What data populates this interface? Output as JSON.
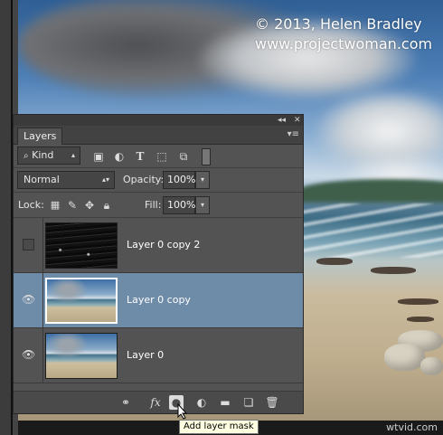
{
  "copyright": {
    "line1": "© 2013, Helen Bradley",
    "line2": "www.projectwoman.com"
  },
  "panel": {
    "collapse_icon": "double-chevron-left-icon",
    "close_icon": "close-icon",
    "tab_label": "Layers",
    "menu_icon": "panel-menu-icon"
  },
  "filter": {
    "kind_label": "Kind",
    "icons": [
      "pixel-filter-icon",
      "adjustment-filter-icon",
      "type-filter-icon",
      "shape-filter-icon",
      "smart-object-filter-icon"
    ]
  },
  "blend": {
    "mode": "Normal",
    "opacity_label": "Opacity:",
    "opacity_value": "100%"
  },
  "lock": {
    "label": "Lock:",
    "fill_label": "Fill:",
    "fill_value": "100%"
  },
  "layers": [
    {
      "name": "Layer 0 copy 2",
      "visible": false,
      "selected": false
    },
    {
      "name": "Layer 0 copy",
      "visible": true,
      "selected": true
    },
    {
      "name": "Layer 0",
      "visible": true,
      "selected": false
    }
  ],
  "bottom_bar": {
    "icons": [
      "link-icon",
      "fx-icon",
      "add-mask-icon",
      "adjustment-layer-icon",
      "group-folder-icon",
      "new-layer-icon",
      "trash-icon"
    ],
    "fx_label": "fx"
  },
  "tooltip": "Add layer mask",
  "watermark": "wtvid.com",
  "colors": {
    "panel_bg": "#535353",
    "selected_row": "#6e8ba8"
  }
}
